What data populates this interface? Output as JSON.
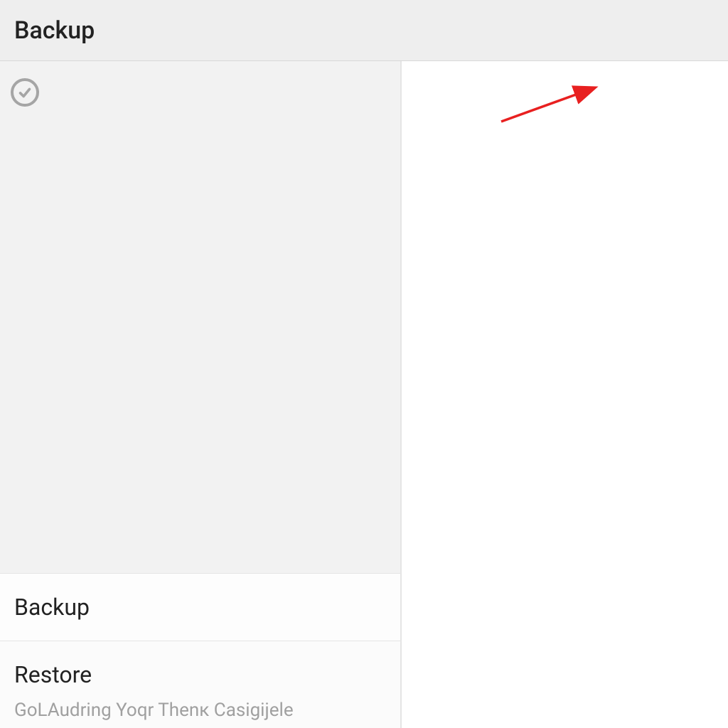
{
  "header": {
    "title": "Backup"
  },
  "icons": {
    "check": "check-circle-icon"
  },
  "leftPanel": {
    "items": [
      {
        "title": "Backup",
        "subtitle": ""
      },
      {
        "title": "Restore",
        "subtitle": "GoLAudring Yoqr Thenк Casigijele"
      }
    ]
  },
  "annotation": {
    "color": "#e82020"
  }
}
